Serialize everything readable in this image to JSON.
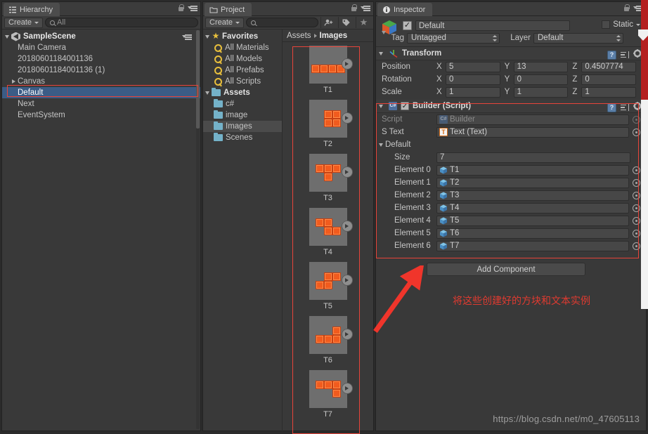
{
  "hierarchy": {
    "tab_label": "Hierarchy",
    "tab_icon": "hierarchy-icon",
    "create_label": "Create",
    "search_value": "All",
    "scene_name": "SampleScene",
    "items": [
      {
        "label": "Main Camera",
        "indent": 1,
        "expandable": false,
        "selected": false
      },
      {
        "label": "20180601184001136",
        "indent": 1,
        "expandable": false,
        "selected": false
      },
      {
        "label": "20180601184001136 (1)",
        "indent": 1,
        "expandable": false,
        "selected": false
      },
      {
        "label": "Canvas",
        "indent": 1,
        "expandable": true,
        "selected": false
      },
      {
        "label": "Default",
        "indent": 1,
        "expandable": false,
        "selected": true
      },
      {
        "label": "Next",
        "indent": 1,
        "expandable": false,
        "selected": false
      },
      {
        "label": "EventSystem",
        "indent": 1,
        "expandable": false,
        "selected": false
      }
    ]
  },
  "project": {
    "tab_label": "Project",
    "tab_icon": "folder-icon",
    "create_label": "Create",
    "search_value": "",
    "toolbar_icons": [
      "save-search-icon",
      "label-icon",
      "favorite-star-icon"
    ],
    "tree": [
      {
        "label": "Favorites",
        "type": "star",
        "indent": 0,
        "expanded": true,
        "selected": false
      },
      {
        "label": "All Materials",
        "type": "search",
        "indent": 1,
        "selected": false
      },
      {
        "label": "All Models",
        "type": "search",
        "indent": 1,
        "selected": false
      },
      {
        "label": "All Prefabs",
        "type": "search",
        "indent": 1,
        "selected": false
      },
      {
        "label": "All Scripts",
        "type": "search",
        "indent": 1,
        "selected": false
      },
      {
        "label": "Assets",
        "type": "folder",
        "indent": 0,
        "expanded": true,
        "selected": false
      },
      {
        "label": "c#",
        "type": "folder",
        "indent": 1,
        "selected": false
      },
      {
        "label": "image",
        "type": "folder",
        "indent": 1,
        "selected": false
      },
      {
        "label": "Images",
        "type": "folder",
        "indent": 1,
        "selected": true
      },
      {
        "label": "Scenes",
        "type": "folder",
        "indent": 1,
        "selected": false
      }
    ],
    "breadcrumb": {
      "root": "Assets",
      "current": "Images"
    },
    "assets": [
      {
        "name": "T1",
        "shape": "I-piece",
        "cells": [
          [
            0,
            1
          ],
          [
            1,
            1
          ],
          [
            2,
            1
          ],
          [
            3,
            1
          ]
        ]
      },
      {
        "name": "T2",
        "shape": "O-piece",
        "cells": [
          [
            1,
            0
          ],
          [
            2,
            0
          ],
          [
            1,
            1
          ],
          [
            2,
            1
          ]
        ]
      },
      {
        "name": "T3",
        "shape": "T-piece",
        "cells": [
          [
            0,
            0
          ],
          [
            1,
            0
          ],
          [
            2,
            0
          ],
          [
            1,
            1
          ]
        ]
      },
      {
        "name": "T4",
        "shape": "S-piece",
        "cells": [
          [
            0,
            0
          ],
          [
            1,
            0
          ],
          [
            1,
            1
          ],
          [
            2,
            1
          ]
        ]
      },
      {
        "name": "T5",
        "shape": "Z-piece",
        "cells": [
          [
            1,
            0
          ],
          [
            2,
            0
          ],
          [
            0,
            1
          ],
          [
            1,
            1
          ]
        ]
      },
      {
        "name": "T6",
        "shape": "J-piece",
        "cells": [
          [
            2,
            0
          ],
          [
            0,
            1
          ],
          [
            1,
            1
          ],
          [
            2,
            1
          ]
        ]
      },
      {
        "name": "T7",
        "shape": "L-piece",
        "cells": [
          [
            0,
            0
          ],
          [
            1,
            0
          ],
          [
            2,
            0
          ],
          [
            2,
            1
          ]
        ]
      }
    ]
  },
  "inspector": {
    "tab_label": "Inspector",
    "tab_icon": "info-icon",
    "object": {
      "icon": "prefab-cube-icon",
      "enabled": true,
      "name": "Default",
      "static_label": "Static",
      "static_checked": false,
      "tag_label": "Tag",
      "tag_value": "Untagged",
      "layer_label": "Layer",
      "layer_value": "Default"
    },
    "transform": {
      "title": "Transform",
      "icon": "transform-axes-icon",
      "rows": [
        {
          "label": "Position",
          "x": "5",
          "y": "13",
          "z": "0.4507774"
        },
        {
          "label": "Rotation",
          "x": "0",
          "y": "0",
          "z": "0"
        },
        {
          "label": "Scale",
          "x": "1",
          "y": "1",
          "z": "1"
        }
      ]
    },
    "builder": {
      "title": "Builder (Script)",
      "icon": "csharp-script-icon",
      "enabled": true,
      "script_label": "Script",
      "script_value": "Builder",
      "stext_label": "S Text",
      "stext_value": "Text (Text)",
      "array_label": "Default",
      "size_label": "Size",
      "size_value": "7",
      "elements": [
        {
          "label": "Element 0",
          "value": "T1"
        },
        {
          "label": "Element 1",
          "value": "T2"
        },
        {
          "label": "Element 2",
          "value": "T3"
        },
        {
          "label": "Element 3",
          "value": "T4"
        },
        {
          "label": "Element 4",
          "value": "T5"
        },
        {
          "label": "Element 5",
          "value": "T6"
        },
        {
          "label": "Element 6",
          "value": "T7"
        }
      ]
    },
    "add_component_label": "Add Component"
  },
  "annotations": {
    "note_text": "将这些创建好的方块和文本实例",
    "arrow": "red-arrow-up-right",
    "highlight_color": "#e8443a"
  },
  "watermark": "https://blog.csdn.net/m0_47605113",
  "colors": {
    "panel_bg": "#393939",
    "chrome_bg": "#3c3c3c",
    "selection_blue": "#3b5c86",
    "annotation_red": "#e8443a",
    "tetromino_orange": "#f15b1e"
  }
}
